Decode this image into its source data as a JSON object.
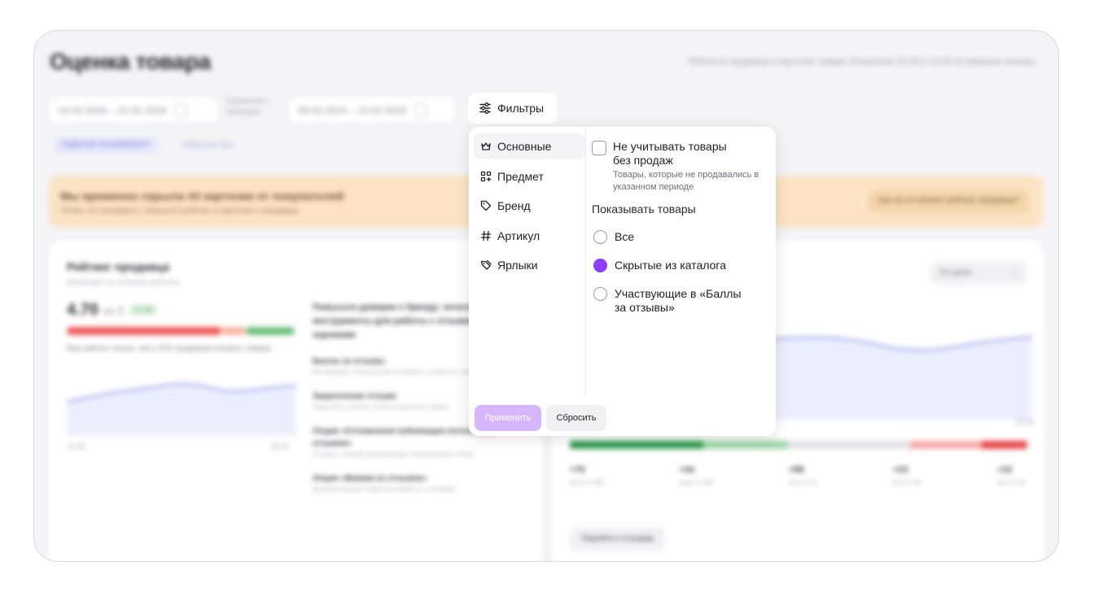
{
  "page": {
    "title": "Оценка товара",
    "header_note": "Рейтинги продавца и карточек товара обновлены 22.06 в 14:00 по времени москвы",
    "date_range": "14.02.2024 – 22.02.2024",
    "compare_label": "Сравнение с периодом",
    "compare_range": "09.02.2024 – 13.02.2024",
    "chip_label": "Скрытые из каталога",
    "reset_all": "Сбросить все"
  },
  "banner": {
    "title": "Мы временно скрыли 43 карточки от покупателей",
    "subtitle": "Чтобы это исправить, повысьте рейтинг в карточке и продавца",
    "button": "Как на это влияет рейтинг продавца?"
  },
  "seller_card": {
    "title": "Рейтинг продавца",
    "subtitle": "Влияющее на значение рейтинга",
    "score": "4.70",
    "of": "из 5",
    "delta": "+0.08",
    "description": "Ваш рейтинг лучше, чем у 40% продавцов похожих товаров",
    "axis_start": "22.08",
    "axis_end": "08.08",
    "tips_heading": "Повысьте доверие к бренду: используйте инструменты для работы с отзывами и оценками",
    "tips": [
      {
        "title": "Баллы за отзывы",
        "text": "Мотивируйте покупателей оставлять отзывы на товары"
      },
      {
        "title": "Закрепление отзыва",
        "text": "Закрепите лучшие отзывы в карточке товара"
      },
      {
        "title": "Опция «Отложенная публикация негативных отзывов»",
        "text": "Отзывы с низкой оценкой будут опубликованы позже"
      },
      {
        "title": "Опция «Вжжжж из отзывов»",
        "text": "Дополнительная опция для работы с отзывами"
      }
    ]
  },
  "reviews_card": {
    "period_select": "По дням",
    "axis_end": "08.08",
    "stats": [
      {
        "value": "+75",
        "sub": "всего 4 080"
      },
      {
        "value": "+34",
        "sub": "всего 1 584"
      },
      {
        "value": "+88",
        "sub": "всего 471"
      },
      {
        "value": "+23",
        "sub": "всего 184"
      },
      {
        "value": "+10",
        "sub": "всего 145"
      }
    ],
    "go_button": "Перейти к отзывам"
  },
  "filters": {
    "button_label": "Фильтры",
    "nav": [
      {
        "label": "Основные",
        "icon": "crown-icon",
        "active": true
      },
      {
        "label": "Предмет",
        "icon": "grid-icon",
        "active": false
      },
      {
        "label": "Бренд",
        "icon": "tag-icon",
        "active": false
      },
      {
        "label": "Артикул",
        "icon": "hash-icon",
        "active": false
      },
      {
        "label": "Ярлыки",
        "icon": "label-icon",
        "active": false
      }
    ],
    "exclude_checkbox": {
      "label": "Не учитывать товары без продаж",
      "hint": "Товары, которые не продавались в указанном периоде",
      "checked": false
    },
    "show_section": "Показывать товары",
    "radio_options": [
      {
        "label": "Все",
        "selected": false
      },
      {
        "label": "Скрытые из каталога",
        "selected": true
      },
      {
        "label": "Участвующие в «Баллы за отзывы»",
        "selected": false
      }
    ],
    "apply_label": "Применить",
    "reset_label": "Сбросить"
  },
  "colors": {
    "accent": "#8b3dff",
    "apply_disabled": "#d5b6ff",
    "banner_bg": "#fbe3c4"
  }
}
